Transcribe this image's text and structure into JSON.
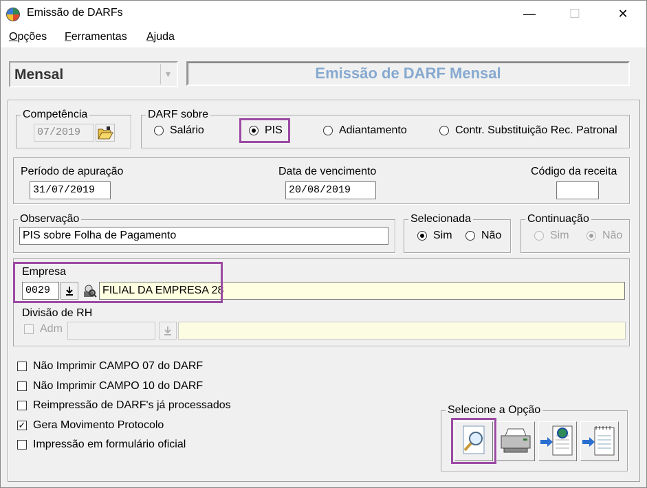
{
  "window": {
    "title": "Emissão de DARFs",
    "minimize": "—",
    "maximize": "☐",
    "close": "✕"
  },
  "menu": {
    "opcoes": {
      "u": "O",
      "rest": "pções"
    },
    "ferramentas": {
      "u": "F",
      "rest": "erramentas"
    },
    "ajuda": {
      "u": "A",
      "rest": "juda"
    }
  },
  "mode_combo": {
    "value": "Mensal"
  },
  "banner": {
    "text": "Emissão de DARF Mensal"
  },
  "competencia": {
    "label": "Competência",
    "value": "07/2019"
  },
  "darf_sobre": {
    "label": "DARF sobre",
    "options": [
      "Salário",
      "PIS",
      "Adiantamento",
      "Contr. Substituição Rec. Patronal"
    ],
    "selected": "PIS"
  },
  "periodo": {
    "label": "Período de apuração",
    "value": "31/07/2019"
  },
  "vencimento": {
    "label": "Data de vencimento",
    "value": "20/08/2019"
  },
  "codigo_receita": {
    "label": "Código da receita",
    "value": ""
  },
  "observacao": {
    "label": "Observação",
    "value": "PIS sobre Folha de Pagamento"
  },
  "selecionada": {
    "label": "Selecionada",
    "sim": "Sim",
    "nao": "Não",
    "selected": "Sim"
  },
  "continuacao": {
    "label": "Continuação",
    "sim": "Sim",
    "nao": "Não",
    "selected": "Não"
  },
  "empresa": {
    "label": "Empresa",
    "code": "0029",
    "name": "FILIAL DA EMPRESA 28"
  },
  "divisao": {
    "label": "Divisão de RH",
    "adm_label": "Adm",
    "value": ""
  },
  "options_checks": [
    {
      "label": "Não Imprimir CAMPO 07 do DARF",
      "checked": false
    },
    {
      "label": "Não Imprimir CAMPO 10 do DARF",
      "checked": false
    },
    {
      "label": "Reimpressão de DARF's já processados",
      "checked": false
    },
    {
      "label": "Gera Movimento Protocolo",
      "checked": true
    },
    {
      "label": "Impressão em formulário oficial",
      "checked": false
    }
  ],
  "selecione": {
    "label": "Selecione a Opção"
  },
  "highlight_color": "#9b4aa3"
}
